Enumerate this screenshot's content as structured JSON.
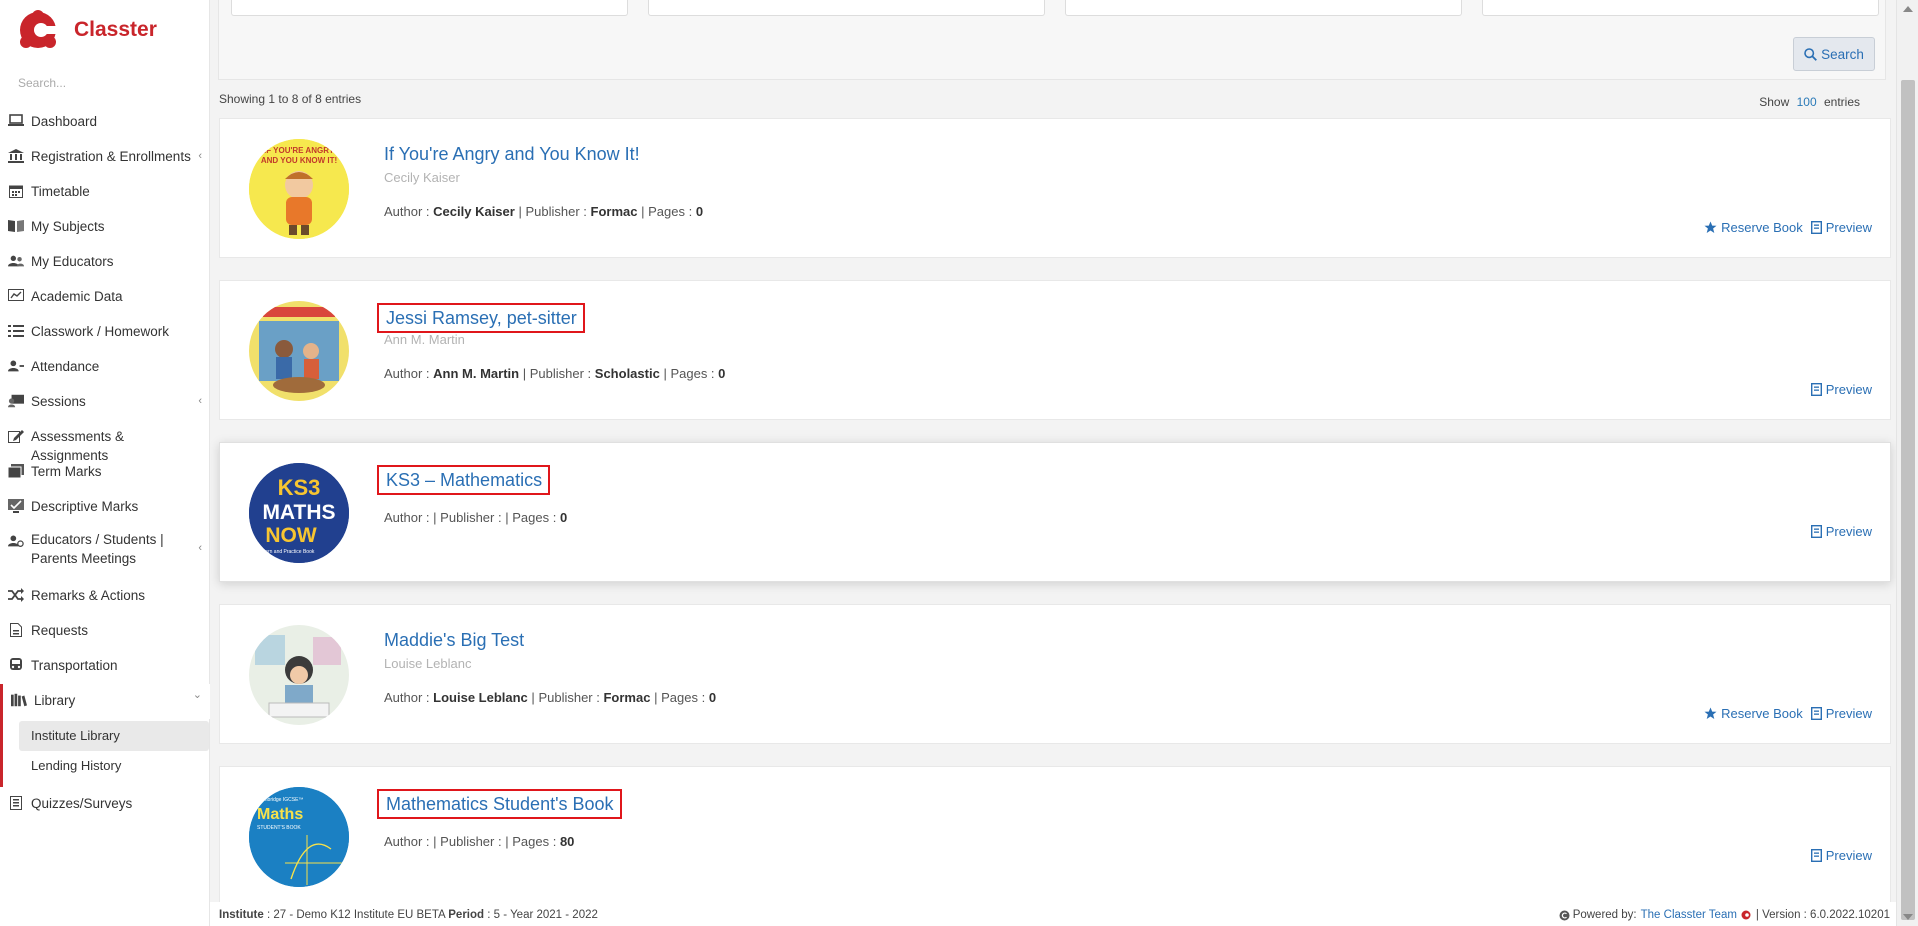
{
  "app": {
    "name": "Classter",
    "brand_color": "#c9252b"
  },
  "sidebar": {
    "search_placeholder": "Search...",
    "items": [
      {
        "label": "Dashboard",
        "icon": "laptop-icon"
      },
      {
        "label": "Registration & Enrollments",
        "icon": "bank-icon",
        "caret": "‹"
      },
      {
        "label": "Timetable",
        "icon": "calendar-icon"
      },
      {
        "label": "My Subjects",
        "icon": "book-icon"
      },
      {
        "label": "My Educators",
        "icon": "users-icon"
      },
      {
        "label": "Academic Data",
        "icon": "chart-icon"
      },
      {
        "label": "Classwork / Homework",
        "icon": "list-icon"
      },
      {
        "label": "Attendance",
        "icon": "user-check-icon"
      },
      {
        "label": "Sessions",
        "icon": "sessions-icon",
        "caret": "‹"
      },
      {
        "label": "Assessments & Assignments",
        "icon": "edit-icon"
      },
      {
        "label": "Term Marks",
        "icon": "marks-icon"
      },
      {
        "label": "Descriptive Marks",
        "icon": "descriptive-icon"
      },
      {
        "label": "Educators / Students | Parents Meetings",
        "icon": "meeting-icon",
        "caret": "‹"
      },
      {
        "label": "Remarks & Actions",
        "icon": "shuffle-icon"
      },
      {
        "label": "Requests",
        "icon": "request-icon"
      },
      {
        "label": "Transportation",
        "icon": "bus-icon"
      },
      {
        "label": "Library",
        "icon": "library-icon",
        "caret": "⌄"
      },
      {
        "label": "Quizzes/Surveys",
        "icon": "quiz-icon"
      }
    ],
    "library_sub": [
      {
        "label": "Institute Library"
      },
      {
        "label": "Lending History"
      }
    ]
  },
  "toolbar": {
    "search_label": "Search"
  },
  "listing": {
    "showing": "Showing 1 to 8 of 8 entries",
    "show_prefix": "Show",
    "show_count": "100",
    "show_suffix": "entries"
  },
  "books": [
    {
      "title": "If You're Angry and You Know It!",
      "subtitle": "Cecily Kaiser",
      "author": "Cecily Kaiser",
      "publisher": "Formac",
      "pages": "0",
      "reserve": "Reserve Book",
      "preview": "Preview"
    },
    {
      "title": "Jessi Ramsey, pet-sitter",
      "subtitle": "Ann M. Martin",
      "author": "Ann M. Martin",
      "publisher": "Scholastic",
      "pages": "0",
      "preview": "Preview"
    },
    {
      "title": "KS3 – Mathematics",
      "subtitle": "",
      "author": "",
      "publisher": "",
      "pages": "0",
      "preview": "Preview",
      "cover_text": [
        "KS3",
        "MATHS",
        "NOW",
        "Learn and Practice Book"
      ]
    },
    {
      "title": "Maddie's Big Test",
      "subtitle": "Louise Leblanc",
      "author": "Louise Leblanc",
      "publisher": "Formac",
      "pages": "0",
      "reserve": "Reserve Book",
      "preview": "Preview"
    },
    {
      "title": "Mathematics Student's Book",
      "subtitle": "",
      "author": "",
      "publisher": "",
      "pages": "80",
      "preview": "Preview",
      "cover_text": [
        "Cambridge IGCSE™",
        "Maths",
        "STUDENT'S BOOK"
      ]
    }
  ],
  "labels": {
    "author": "Author :",
    "publisher": "Publisher :",
    "pages": "Pages :",
    "sep": "|"
  },
  "footer": {
    "institute_label": "Institute",
    "institute_value": ": 27 - Demo K12 Institute EU BETA",
    "period_label": "Period",
    "period_value": ": 5 - Year 2021 - 2022",
    "powered_by": "Powered by:",
    "team": "The Classter Team",
    "version": "| Version : 6.0.2022.10201"
  }
}
